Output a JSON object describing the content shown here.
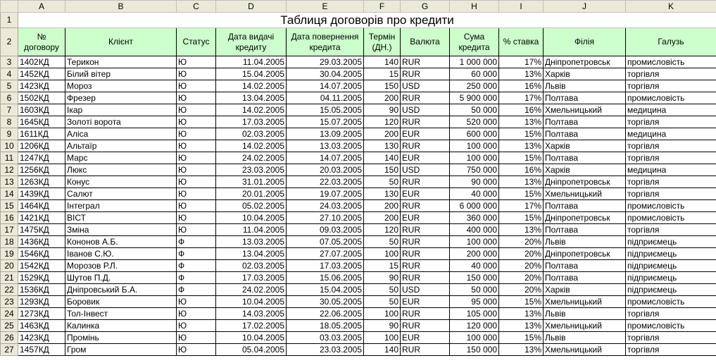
{
  "columns": [
    "A",
    "B",
    "C",
    "D",
    "E",
    "F",
    "G",
    "H",
    "I",
    "J",
    "K"
  ],
  "title": "Таблиця договорів про кредити",
  "headers": [
    "№ договору",
    "Клієнт",
    "Статус",
    "Дата видачі кредиту",
    "Дата повернення кредита",
    "Термін (ДН.)",
    "Валюта",
    "Сума кредита",
    "% ставка",
    "Філія",
    "Галузь"
  ],
  "rows": [
    {
      "n": "3",
      "c": [
        "1402КД",
        "Терикон",
        "Ю",
        "11.04.2005",
        "29.03.2005",
        "140",
        "RUR",
        "1 000 000",
        "17%",
        "Дніпропетровськ",
        "промисловість"
      ]
    },
    {
      "n": "4",
      "c": [
        "1452КД",
        "Білий вітер",
        "Ю",
        "15.04.2005",
        "30.04.2005",
        "15",
        "RUR",
        "60 000",
        "13%",
        "Харків",
        "торгівля"
      ]
    },
    {
      "n": "5",
      "c": [
        "1423КД",
        "Мороз",
        "Ю",
        "14.02.2005",
        "14.07.2005",
        "150",
        "USD",
        "250 000",
        "16%",
        "Львів",
        "торгівля"
      ]
    },
    {
      "n": "6",
      "c": [
        "1502КД",
        "Фрезер",
        "Ю",
        "13.04.2005",
        "04.11.2005",
        "200",
        "RUR",
        "5 900 000",
        "17%",
        "Полтава",
        "промисловість"
      ]
    },
    {
      "n": "7",
      "c": [
        "1603КД",
        "Ікар",
        "Ю",
        "14.02.2005",
        "15.05.2005",
        "90",
        "USD",
        "50 000",
        "16%",
        "Хмельницький",
        "медицина"
      ]
    },
    {
      "n": "8",
      "c": [
        "1645КД",
        "Золоті ворота",
        "Ю",
        "17.03.2005",
        "15.07.2005",
        "120",
        "RUR",
        "520 000",
        "13%",
        "Полтава",
        "торгівля"
      ]
    },
    {
      "n": "9",
      "c": [
        "1611КД",
        "Аліса",
        "Ю",
        "02.03.2005",
        "13.09.2005",
        "200",
        "EUR",
        "600 000",
        "15%",
        "Полтава",
        "медицина"
      ]
    },
    {
      "n": "10",
      "c": [
        "1206КД",
        "Альтаїр",
        "Ю",
        "14.02.2005",
        "13.03.2005",
        "130",
        "RUR",
        "100 000",
        "13%",
        "Харків",
        "торгівля"
      ]
    },
    {
      "n": "11",
      "c": [
        "1247КД",
        "Марс",
        "Ю",
        "24.02.2005",
        "14.07.2005",
        "140",
        "EUR",
        "100 000",
        "15%",
        "Полтава",
        "торгівля"
      ]
    },
    {
      "n": "12",
      "c": [
        "1256КД",
        "Люкс",
        "Ю",
        "23.03.2005",
        "20.03.2005",
        "150",
        "USD",
        "750 000",
        "16%",
        "Харків",
        "медицина"
      ]
    },
    {
      "n": "13",
      "c": [
        "1263КД",
        "Конус",
        "Ю",
        "31.01.2005",
        "22.03.2005",
        "50",
        "RUR",
        "90 000",
        "13%",
        "Дніпропетровськ",
        "торгівля"
      ]
    },
    {
      "n": "14",
      "c": [
        "1439КД",
        "Салют",
        "Ю",
        "20.01.2005",
        "19.07.2005",
        "130",
        "EUR",
        "40 000",
        "15%",
        "Хмельницький",
        "торгівля"
      ]
    },
    {
      "n": "15",
      "c": [
        "1464КД",
        "Інтеграл",
        "Ю",
        "05.02.2005",
        "24.03.2005",
        "200",
        "RUR",
        "6 000 000",
        "17%",
        "Полтава",
        "промисловість"
      ]
    },
    {
      "n": "16",
      "c": [
        "1421КД",
        "ВІСТ",
        "Ю",
        "10.04.2005",
        "27.10.2005",
        "200",
        "EUR",
        "360 000",
        "15%",
        "Дніпропетровськ",
        "промисловість"
      ]
    },
    {
      "n": "17",
      "c": [
        "1475КД",
        "Зміна",
        "Ю",
        "11.04.2005",
        "09.03.2005",
        "120",
        "RUR",
        "400 000",
        "13%",
        "Полтава",
        "торгівля"
      ]
    },
    {
      "n": "18",
      "c": [
        "1436КД",
        "Кононов А.Б.",
        "Ф",
        "13.03.2005",
        "07.05.2005",
        "50",
        "RUR",
        "100 000",
        "20%",
        "Львів",
        "підприємець"
      ]
    },
    {
      "n": "19",
      "c": [
        "1546КД",
        "Іванов С.Ю.",
        "Ф",
        "13.04.2005",
        "27.07.2005",
        "100",
        "RUR",
        "200 000",
        "20%",
        "Дніпропетровськ",
        "підприємець"
      ]
    },
    {
      "n": "20",
      "c": [
        "1542КД",
        "Морозов Р.Л.",
        "Ф",
        "02.03.2005",
        "17.03.2005",
        "15",
        "RUR",
        "40 000",
        "20%",
        "Полтава",
        "підприємець"
      ]
    },
    {
      "n": "21",
      "c": [
        "1529КД",
        "Шутов П.Д.",
        "Ф",
        "17.03.2005",
        "15.06.2005",
        "90",
        "RUR",
        "150 000",
        "20%",
        "Полтава",
        "підприємець"
      ]
    },
    {
      "n": "22",
      "c": [
        "1536КД",
        "Дніпровський  Б.А.",
        "Ф",
        "24.02.2005",
        "15.04.2005",
        "50",
        "USD",
        "50 000",
        "20%",
        "Харків",
        "підприємець"
      ]
    },
    {
      "n": "23",
      "c": [
        "1293КД",
        "Боровик",
        "Ю",
        "10.04.2005",
        "30.05.2005",
        "50",
        "EUR",
        "95 000",
        "15%",
        "Хмельницький",
        "промисловість"
      ]
    },
    {
      "n": "24",
      "c": [
        "1273КД",
        "Тол-Інвест",
        "Ю",
        "14.03.2005",
        "22.06.2005",
        "100",
        "RUR",
        "105 000",
        "13%",
        "Львів",
        "торгівля"
      ]
    },
    {
      "n": "25",
      "c": [
        "1463КД",
        "Калинка",
        "Ю",
        "17.02.2005",
        "18.05.2005",
        "90",
        "RUR",
        "120 000",
        "13%",
        "Хмельницький",
        "промисловість"
      ]
    },
    {
      "n": "26",
      "c": [
        "1423КД",
        "Промінь",
        "Ю",
        "10.04.2005",
        "03.03.2005",
        "100",
        "EUR",
        "100 000",
        "15%",
        "Львів",
        "торгівля"
      ]
    },
    {
      "n": "27",
      "c": [
        "1457КД",
        "Гром",
        "Ю",
        "05.04.2005",
        "23.03.2005",
        "140",
        "RUR",
        "150 000",
        "13%",
        "Хмельницький",
        "торгівля"
      ]
    }
  ]
}
